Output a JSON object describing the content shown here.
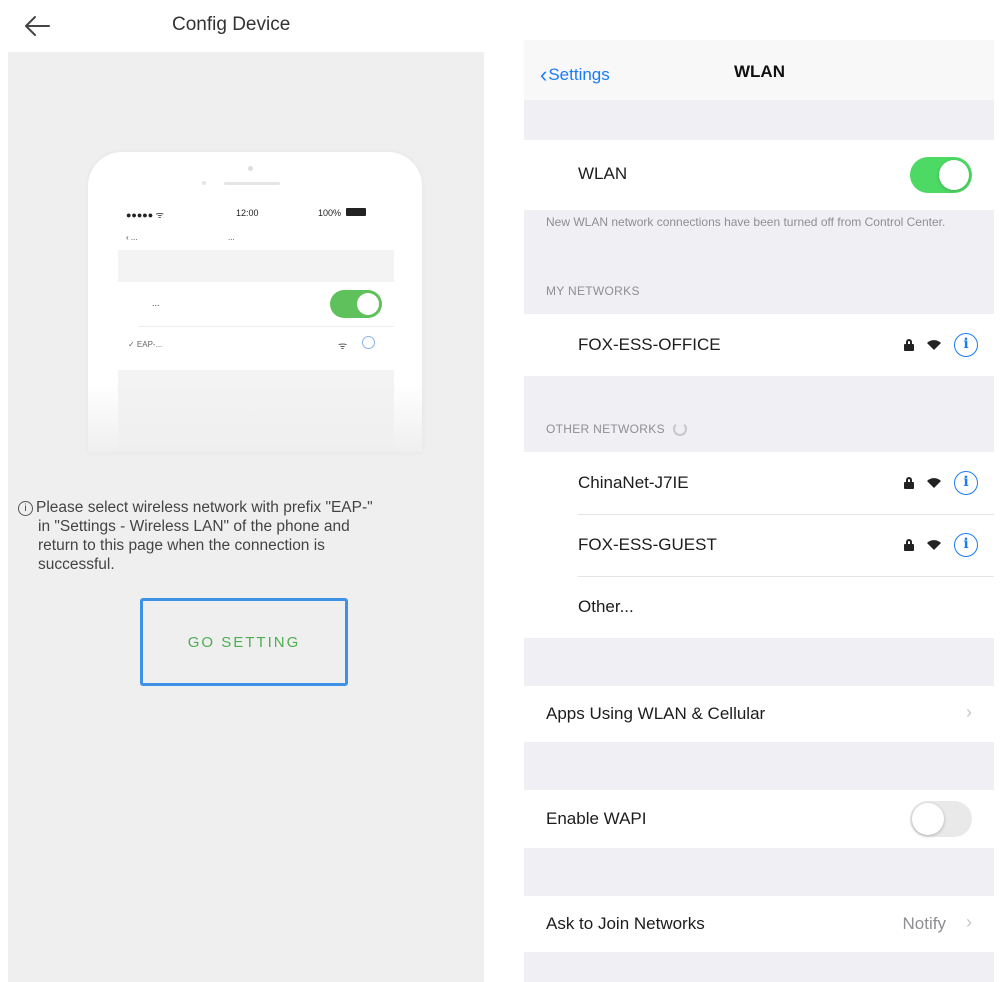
{
  "left": {
    "title": "Config Device",
    "mockup": {
      "carrier": "●●●●● ᯤ",
      "time": "12:00",
      "battery": "100%",
      "back": "‹ ...",
      "nav_title": "...",
      "wlan_label": "...",
      "network": "✓ EAP-...",
      "toggle_color": "#5fc15c"
    },
    "hint": {
      "icon": "i",
      "line1": "Please select wireless network with prefix \"EAP-\"",
      "line2": "in \"Settings - Wireless LAN\" of the phone and",
      "line3": "return to this page when the connection is",
      "line4": "successful."
    },
    "button_label": "GO SETTING",
    "button_border_color": "#3d92e6",
    "button_text_color": "#4caf50"
  },
  "right": {
    "back_label": "Settings",
    "title": "WLAN",
    "wlan_label": "WLAN",
    "wlan_on": true,
    "notice": "New WLAN network connections have been turned off from Control Center.",
    "my_networks_header": "MY NETWORKS",
    "my_networks": [
      {
        "name": "FOX-ESS-OFFICE",
        "secured": true
      }
    ],
    "other_networks_header": "OTHER NETWORKS",
    "other_networks": [
      {
        "name": "ChinaNet-J7IE",
        "secured": true
      },
      {
        "name": "FOX-ESS-GUEST",
        "secured": true
      }
    ],
    "other_label": "Other...",
    "apps_label": "Apps Using WLAN & Cellular",
    "wapi_label": "Enable WAPI",
    "wapi_on": false,
    "ask_label": "Ask to Join Networks",
    "ask_value": "Notify",
    "accent_color": "#1a7cf5",
    "toggle_on_color": "#4cd964"
  }
}
